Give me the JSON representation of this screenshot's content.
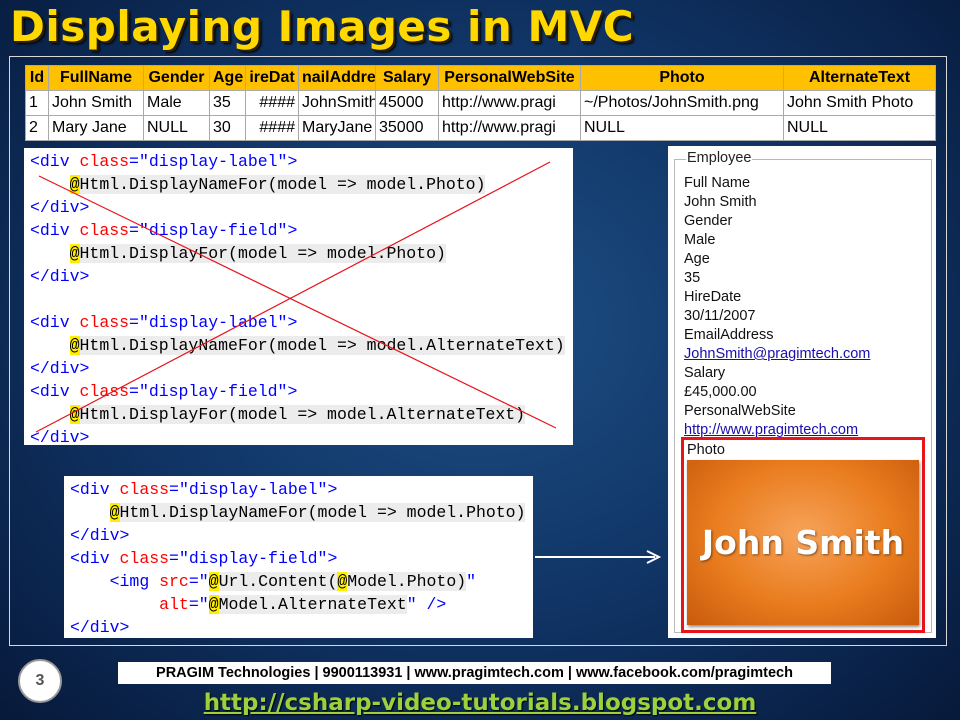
{
  "title": "Displaying Images in MVC",
  "table": {
    "headers": [
      "Id",
      "FullName",
      "Gender",
      "Age",
      "ireDat",
      "nailAddre",
      "Salary",
      "PersonalWebSite",
      "Photo",
      "AlternateText"
    ],
    "rows": [
      [
        "1",
        "John Smith",
        "Male",
        "35",
        "####",
        "JohnSmith",
        "45000",
        "http://www.pragi",
        "~/Photos/JohnSmith.png",
        "John Smith Photo"
      ],
      [
        "2",
        "Mary Jane",
        "NULL",
        "30",
        "####",
        "MaryJane",
        "35000",
        "http://www.pragi",
        "NULL",
        "NULL"
      ]
    ]
  },
  "code_top": {
    "l1_open": "<div ",
    "l1_class": "class",
    "l1_eq": "=",
    "l1_val": "\"display-label\"",
    "l1_close": ">",
    "l2_at": "@",
    "l2_code": "Html.DisplayNameFor(model => model.Photo)",
    "l3": "</div>",
    "l4_open": "<div ",
    "l4_class": "class",
    "l4_eq": "=",
    "l4_val": "\"display-field\"",
    "l4_close": ">",
    "l5_at": "@",
    "l5_code": "Html.DisplayFor(model => model.Photo)",
    "l6": "</div>",
    "l8_open": "<div ",
    "l8_class": "class",
    "l8_eq": "=",
    "l8_val": "\"display-label\"",
    "l8_close": ">",
    "l9_at": "@",
    "l9_code": "Html.DisplayNameFor(model => model.AlternateText)",
    "l10": "</div>",
    "l11_open": "<div ",
    "l11_class": "class",
    "l11_eq": "=",
    "l11_val": "\"display-field\"",
    "l11_close": ">",
    "l12_at": "@",
    "l12_code": "Html.DisplayFor(model => model.AlternateText)",
    "l13": "</div>"
  },
  "code_bottom": {
    "l1_open": "<div ",
    "l1_class": "class",
    "l1_eq": "=",
    "l1_val": "\"display-label\"",
    "l1_close": ">",
    "l2_at": "@",
    "l2_code": "Html.DisplayNameFor(model => model.Photo)",
    "l3": "</div>",
    "l4_open": "<div ",
    "l4_class": "class",
    "l4_eq": "=",
    "l4_val": "\"display-field\"",
    "l4_close": ">",
    "l5_open": "<img ",
    "l5_src": "src",
    "l5_eq": "=\"",
    "l5_at": "@",
    "l5_code": "Url.Content(",
    "l5_at2": "@",
    "l5_code2": "Model.Photo)",
    "l5_q": "\"",
    "l6_alt": "alt",
    "l6_eq": "=\"",
    "l6_at": "@",
    "l6_code": "Model.AlternateText",
    "l6_q": "\"",
    "l6_close": " />",
    "l7": "</div>"
  },
  "employee": {
    "legend": "Employee",
    "lines": [
      "Full Name",
      "John Smith",
      "Gender",
      "Male",
      "Age",
      "35",
      "HireDate",
      "30/11/2007",
      "EmailAddress",
      "JohnSmith@pragimtech.com",
      "Salary",
      "£45,000.00",
      "PersonalWebSite",
      "http://www.pragimtech.com"
    ],
    "photo_label": "Photo",
    "photo_text": "John Smith"
  },
  "footer": {
    "page_number": "3",
    "bar": "PRAGIM Technologies | 9900113931 | www.pragimtech.com | www.facebook.com/pragimtech",
    "url": "http://csharp-video-tutorials.blogspot.com"
  },
  "colors": {
    "title": "#ffd800",
    "table_header": "#ffc000",
    "cross_line": "#e8141a",
    "photo_orange": "#e97c1e",
    "footer_url": "#9bd13c"
  }
}
